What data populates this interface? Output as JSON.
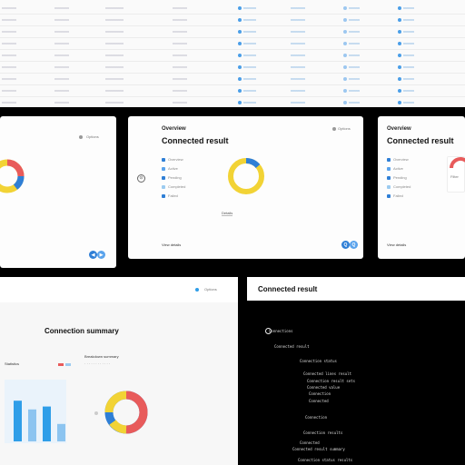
{
  "table": {
    "col_text": [
      "xxxxxxxx",
      "xxxxxxxx",
      "xxxxxxxxxx",
      "xxxxxxxx",
      "xxxxxxx",
      "xxxxxxxx",
      "xxxxxx",
      "xxxxxx"
    ],
    "rows": 9
  },
  "middle": {
    "left_card": {
      "label": "Options"
    },
    "center_card": {
      "top_link": "Options",
      "small_title": "Overview",
      "title": "Connected result",
      "legend": [
        "Overview",
        "Active",
        "Pending",
        "Completed",
        "Failed"
      ],
      "center_button": "Details",
      "footer_text": "View details",
      "btn_a": "Q",
      "btn_b": "Q"
    },
    "right_card": {
      "small_title": "Overview",
      "title": "Connected result",
      "legend": [
        "Overview",
        "Active",
        "Pending",
        "Completed",
        "Failed"
      ],
      "badge": "Filter",
      "footer_text": "View details"
    }
  },
  "bottom": {
    "left_panel": {
      "top_link": "Options",
      "title": "Connection summary",
      "left_label": "Statistics",
      "right_label": "Breakdown summary",
      "bar_values": [
        0.7,
        0.55,
        0.6,
        0.3
      ],
      "donut_center": "9"
    },
    "right_panel": {
      "header_title": "Connected result",
      "lines": [
        "Connections",
        "Connected result",
        "Connection status",
        "Connected lines result",
        "Connection result sets",
        "Connected value",
        "Connection",
        "Connected",
        "Connection",
        "Connection results",
        "Connected",
        "Connected result summary",
        "Connection status results"
      ]
    }
  },
  "colors": {
    "blue": "#2f7fd6",
    "yellow": "#f2d335",
    "red": "#e85b5b",
    "lightblue": "#9ccbf0"
  }
}
